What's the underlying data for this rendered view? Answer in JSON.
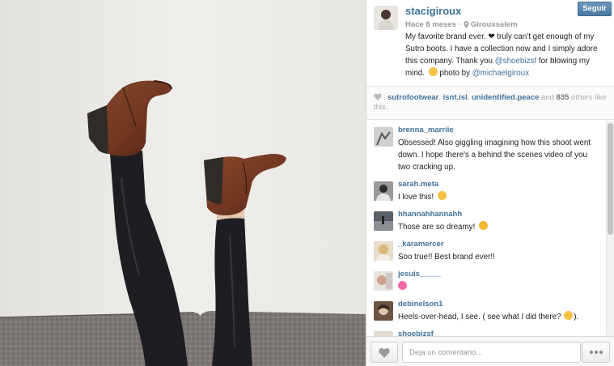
{
  "post": {
    "username": "stacigiroux",
    "time": "Hace 8 meses",
    "location": "Girouxsalem",
    "follow_label": "Seguir",
    "caption": {
      "text_1": "My favorite brand ever. ❤ truly can't get enough of my Sutro boots. I have a collection now and I simply adore this company. Thank you ",
      "mention_1": "@shoebizsf",
      "text_2": " for blowing my mind. ",
      "text_3": " photo by ",
      "mention_2": "@michaelgiroux"
    }
  },
  "likes": {
    "users": [
      "sutrofootwear",
      "isnt.isl",
      "unidentified.peace"
    ],
    "sep_1": ", ",
    "sep_2": ", ",
    "and_text": " and ",
    "count": "835",
    "others_text": " others like this."
  },
  "comments": [
    {
      "user": "brenna_marriie",
      "text": "Obsessed! Also giggling imagining how this shoot went down. I hope there's a behind the scenes video of you two cracking up.",
      "emoji": ""
    },
    {
      "user": "sarah.meta",
      "text": "I love this!",
      "emoji": "grin"
    },
    {
      "user": "hhannahhannahh",
      "text": "Those are so dreamy!",
      "emoji": "heart-eyes"
    },
    {
      "user": "_karamercer",
      "text": "Soo true!! Best brand ever!!",
      "emoji": ""
    },
    {
      "user": "jesuis_____",
      "text": "",
      "emoji": "two-hearts"
    },
    {
      "user": "debinelson1",
      "text": "Heels-over-head, I see. ( see what I did there? ",
      "emoji": "smirk",
      "text_after": ")."
    },
    {
      "user": "shoebizsf",
      "text": "",
      "emoji": ""
    }
  ],
  "footer": {
    "comment_placeholder": "Deja un comentario..."
  },
  "colors": {
    "link_blue": "#3f729b",
    "follow_button": "#517fa4"
  },
  "icons": [
    "location-pin-icon",
    "heart-icon",
    "more-dots-icon"
  ]
}
